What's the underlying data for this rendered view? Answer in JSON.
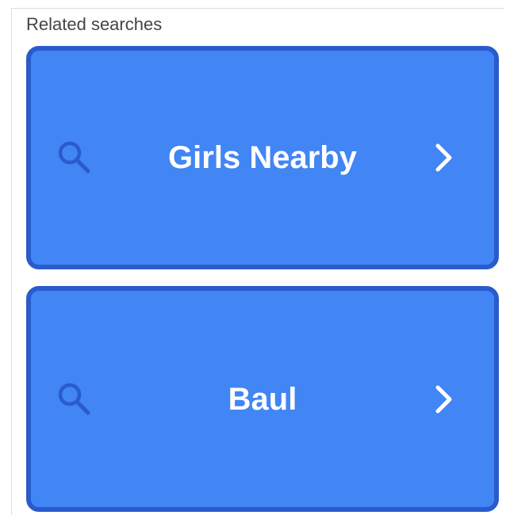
{
  "related_searches": {
    "heading": "Related searches",
    "items": [
      {
        "label": "Girls Nearby",
        "icon": "search-icon",
        "trailing_icon": "chevron-right-icon"
      },
      {
        "label": "Baul",
        "icon": "search-icon",
        "trailing_icon": "chevron-right-icon"
      }
    ]
  },
  "colors": {
    "tile_background": "#4285f4",
    "tile_border": "#2a5bcc",
    "search_icon": "#2a5bcc",
    "tile_text": "#ffffff",
    "heading_text": "#444444"
  }
}
